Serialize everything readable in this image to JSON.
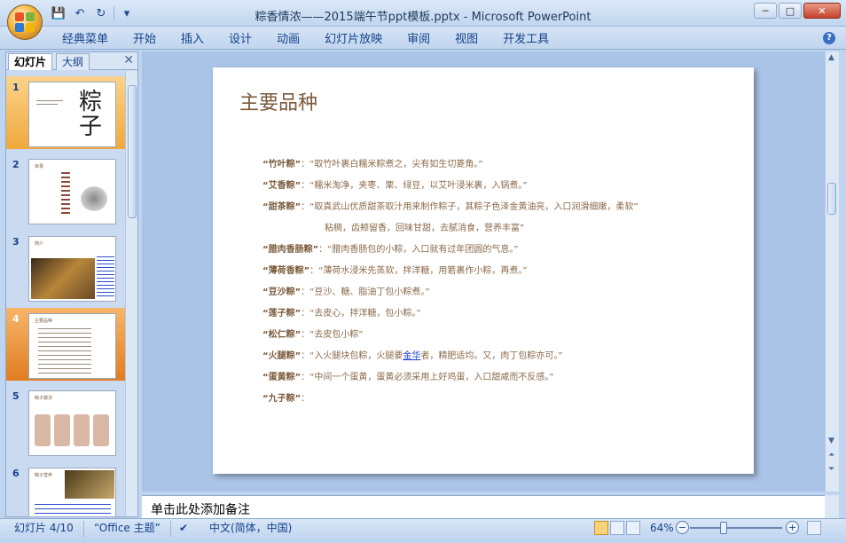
{
  "window": {
    "title": "粽香情浓——2015端午节ppt模板.pptx - Microsoft PowerPoint",
    "controls": [
      "─",
      "□",
      "✕"
    ]
  },
  "quick_access": {
    "save": "💾",
    "undo": "↶",
    "redo": "↻",
    "more": "▾"
  },
  "ribbon": {
    "tabs": [
      "经典菜单",
      "开始",
      "插入",
      "设计",
      "动画",
      "幻灯片放映",
      "审阅",
      "视图",
      "开发工具"
    ],
    "help": "?"
  },
  "left_pane": {
    "tab_slides": "幻灯片",
    "tab_outline": "大纲",
    "close": "✕",
    "thumbnails": [
      {
        "num": "1",
        "title": "粽子"
      },
      {
        "num": "2",
        "title": "目录"
      },
      {
        "num": "3",
        "title": "简介"
      },
      {
        "num": "4",
        "title": "主要品种"
      },
      {
        "num": "5",
        "title": "粽子做法"
      },
      {
        "num": "6",
        "title": "粽子营养"
      }
    ]
  },
  "slide": {
    "title": "主要品种",
    "items": [
      {
        "name": "“竹叶粽”",
        "sep": "：",
        "text": "“取竹叶裹白糯米粽煮之，尖有如生切菱角。”"
      },
      {
        "name": "“艾香粽”",
        "sep": "：",
        "text": "“糯米淘净，夹枣、栗、绿豆，以艾叶浸米裹，入锅煮。”"
      },
      {
        "name": "“甜茶粽”",
        "sep": "：",
        "text": "“取真武山优质甜茶取汁用来制作粽子，其粽子色泽金黄油亮，入口润滑细嫩，柔软”"
      },
      {
        "name": "",
        "sep": "",
        "text": "粘稠，齿颊留香，回味甘甜，去腻消食，营养丰富”"
      },
      {
        "name": "“腊肉香肠粽”",
        "sep": "：",
        "text": "“腊肉香肠包的小粽，入口就有过年团圆的气息。”"
      },
      {
        "name": "“薄荷香粽”",
        "sep": "：",
        "text": "“薄荷水浸米先蒸软，拌洋糖，用箬裹作小粽，再煮。”"
      },
      {
        "name": "“豆沙粽”",
        "sep": "：",
        "text": "“豆沙、糖、脂油丁包小粽煮。”"
      },
      {
        "name": "“莲子粽”",
        "sep": "：",
        "text": "“去皮心，拌洋糖，包小粽。”"
      },
      {
        "name": "“松仁粽”",
        "sep": "：",
        "text": "“去皮包小粽”"
      },
      {
        "name": "“火腿粽”",
        "sep": "：",
        "text_a": "“入火腿块包粽，火腿要",
        "link": "金华",
        "text_b": "者，精肥适均。又，肉丁包粽亦可。”"
      },
      {
        "name": "“蛋黄粽”",
        "sep": "：",
        "text": "“中间一个蛋黄，蛋黄必须采用上好鸡蛋，入口甜咸而不反感。”"
      },
      {
        "name": "“九子粽”",
        "sep": "：",
        "text": ""
      }
    ]
  },
  "notes": {
    "placeholder": "单击此处添加备注"
  },
  "status": {
    "slide": "幻灯片 4/10",
    "theme": "“Office 主题”",
    "language": "中文(简体，中国)",
    "zoom": "64%",
    "zoom_minus": "−",
    "zoom_plus": "+"
  },
  "colors": {
    "accent": "#7a5a3a",
    "ribbon_text": "#15428b",
    "selected_thumb": "#e07d20"
  }
}
